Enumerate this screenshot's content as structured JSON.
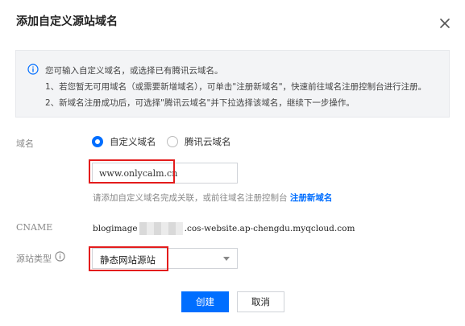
{
  "dialog": {
    "title": "添加自定义源站域名",
    "close_icon": "close-icon"
  },
  "info": {
    "icon": "info-icon",
    "line1": "您可输入自定义域名，或选择已有腾讯云域名。",
    "line2": "1、若您暂无可用域名（或需要新增域名），可单击\"注册新域名\"，快速前往域名注册控制台进行注册。",
    "line3": "2、新域名注册成功后，可选择\"腾讯云域名\"并下拉选择该域名，继续下一步操作。"
  },
  "form": {
    "domain_label": "域名",
    "radio_custom": "自定义域名",
    "radio_tencent": "腾讯云域名",
    "radio_selected": "自定义域名",
    "domain_value": "www.onlycalm.cn",
    "hint_text": "请添加自定义域名完成关联，或前往域名注册控制台 ",
    "hint_link": "注册新域名",
    "cname_label": "CNAME",
    "cname_prefix": "blogimage",
    "cname_suffix": ".cos-website.ap-chengdu.myqcloud.com",
    "origin_type_label": "源站类型",
    "origin_type_value": "静态网站源站"
  },
  "buttons": {
    "create": "创建",
    "cancel": "取消"
  },
  "colors": {
    "accent": "#006eff",
    "highlight": "#e31c1c"
  }
}
